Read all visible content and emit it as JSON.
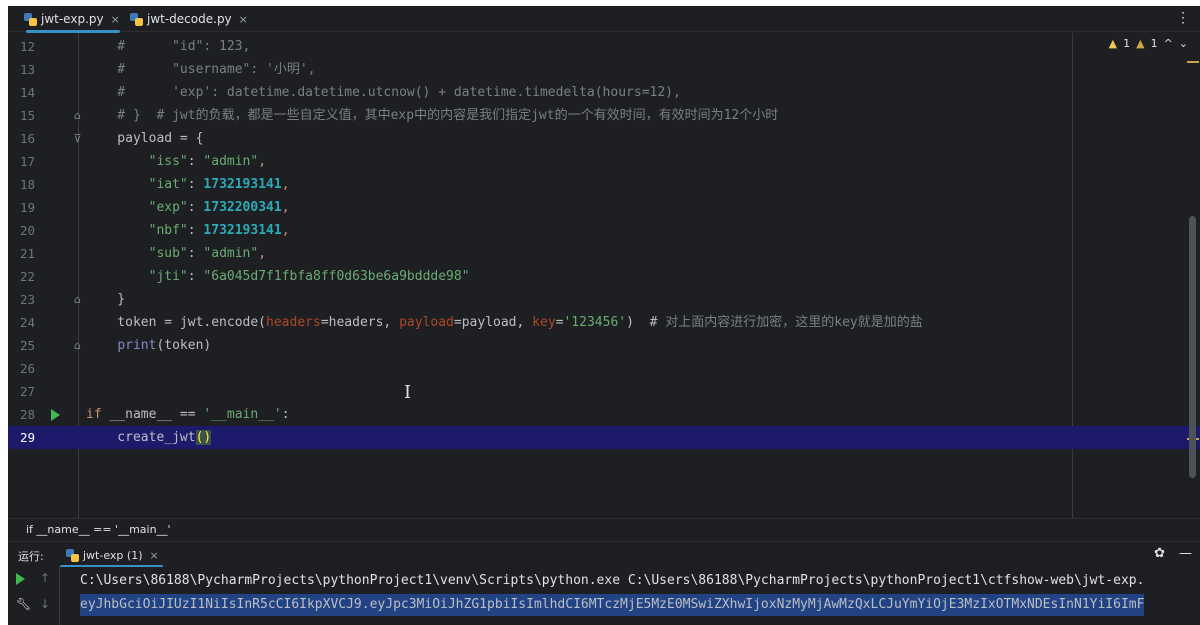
{
  "tabs": [
    {
      "label": "jwt-exp.py",
      "active": true
    },
    {
      "label": "jwt-decode.py",
      "active": false
    }
  ],
  "tab_close": "×",
  "tab_menu": "⋮",
  "inspections": {
    "warnings": "1",
    "weak": "1",
    "up": "^",
    "down": "⌄"
  },
  "code_lines": [
    {
      "n": "12",
      "parts": [
        {
          "t": "    #      \"id\": 123,",
          "c": "cm"
        }
      ]
    },
    {
      "n": "13",
      "parts": [
        {
          "t": "    #      \"username\": '",
          "c": "cm"
        },
        {
          "t": "小明",
          "c": "cm-cn"
        },
        {
          "t": "',",
          "c": "cm"
        }
      ]
    },
    {
      "n": "14",
      "parts": [
        {
          "t": "    #      'exp': datetime.datetime.utcnow() + datetime.timedelta(hours=12),",
          "c": "cm"
        }
      ]
    },
    {
      "n": "15",
      "fold": "end",
      "parts": [
        {
          "t": "    # }  # jwt",
          "c": "cm"
        },
        {
          "t": "的负载，都是一些自定义值，其中",
          "c": "cm-cn"
        },
        {
          "t": "exp",
          "c": "cm"
        },
        {
          "t": "中的内容是我们指定",
          "c": "cm-cn"
        },
        {
          "t": "jwt",
          "c": "cm"
        },
        {
          "t": "的一个有效时间，有效时间为",
          "c": "cm-cn"
        },
        {
          "t": "12",
          "c": "cm"
        },
        {
          "t": "个小时",
          "c": "cm-cn"
        }
      ]
    },
    {
      "n": "16",
      "fold": "start",
      "parts": [
        {
          "t": "    payload = {",
          "c": "fn"
        }
      ]
    },
    {
      "n": "17",
      "parts": [
        {
          "t": "        ",
          "c": "fn"
        },
        {
          "t": "\"iss\"",
          "c": "str"
        },
        {
          "t": ": ",
          "c": "fn"
        },
        {
          "t": "\"admin\"",
          "c": "str"
        },
        {
          "t": ",",
          "c": "kw"
        }
      ]
    },
    {
      "n": "18",
      "parts": [
        {
          "t": "        ",
          "c": "fn"
        },
        {
          "t": "\"iat\"",
          "c": "str"
        },
        {
          "t": ": ",
          "c": "fn"
        },
        {
          "t": "1732193141",
          "c": "num"
        },
        {
          "t": ",",
          "c": "kw"
        }
      ]
    },
    {
      "n": "19",
      "parts": [
        {
          "t": "        ",
          "c": "fn"
        },
        {
          "t": "\"exp\"",
          "c": "str"
        },
        {
          "t": ": ",
          "c": "fn"
        },
        {
          "t": "1732200341",
          "c": "num"
        },
        {
          "t": ",",
          "c": "kw"
        }
      ]
    },
    {
      "n": "20",
      "parts": [
        {
          "t": "        ",
          "c": "fn"
        },
        {
          "t": "\"nbf\"",
          "c": "str"
        },
        {
          "t": ": ",
          "c": "fn"
        },
        {
          "t": "1732193141",
          "c": "num"
        },
        {
          "t": ",",
          "c": "kw"
        }
      ]
    },
    {
      "n": "21",
      "parts": [
        {
          "t": "        ",
          "c": "fn"
        },
        {
          "t": "\"sub\"",
          "c": "str"
        },
        {
          "t": ": ",
          "c": "fn"
        },
        {
          "t": "\"admin\"",
          "c": "str"
        },
        {
          "t": ",",
          "c": "kw"
        }
      ]
    },
    {
      "n": "22",
      "parts": [
        {
          "t": "        ",
          "c": "fn"
        },
        {
          "t": "\"jti\"",
          "c": "str"
        },
        {
          "t": ": ",
          "c": "fn"
        },
        {
          "t": "\"6a045d7f1fbfa8ff0d63be6a9bddde98\"",
          "c": "str"
        }
      ]
    },
    {
      "n": "23",
      "fold": "end",
      "parts": [
        {
          "t": "    }",
          "c": "fn"
        }
      ]
    },
    {
      "n": "24",
      "parts": [
        {
          "t": "    token = jwt.encode(",
          "c": "fn"
        },
        {
          "t": "headers",
          "c": "par"
        },
        {
          "t": "=headers, ",
          "c": "fn"
        },
        {
          "t": "payload",
          "c": "par"
        },
        {
          "t": "=payload, ",
          "c": "fn"
        },
        {
          "t": "key",
          "c": "par"
        },
        {
          "t": "=",
          "c": "fn"
        },
        {
          "t": "'123456'",
          "c": "str"
        },
        {
          "t": ")  # ",
          "c": "fn"
        },
        {
          "t": "对上面内容进行加密，这里的",
          "c": "cm-cn"
        },
        {
          "t": "key",
          "c": "cm"
        },
        {
          "t": "就是加的盐",
          "c": "cm-cn"
        }
      ]
    },
    {
      "n": "25",
      "fold": "end",
      "parts": [
        {
          "t": "    ",
          "c": "fn"
        },
        {
          "t": "print",
          "c": "bi"
        },
        {
          "t": "(token)",
          "c": "fn"
        }
      ]
    },
    {
      "n": "26",
      "parts": []
    },
    {
      "n": "27",
      "parts": []
    },
    {
      "n": "28",
      "run": true,
      "parts": [
        {
          "t": "if",
          "c": "kw"
        },
        {
          "t": " __name__ == ",
          "c": "fn"
        },
        {
          "t": "'__main__'",
          "c": "str"
        },
        {
          "t": ":",
          "c": "fn"
        }
      ]
    },
    {
      "n": "29",
      "current": true,
      "parts": [
        {
          "t": "    create_jwt",
          "c": "fn"
        },
        {
          "t": "()",
          "c": "brk-hl"
        }
      ]
    }
  ],
  "text_caret": "I",
  "breadcrumb": "if __name__ == '__main__'",
  "run_panel": {
    "label": "运行:",
    "tab": "jwt-exp (1)",
    "close": "×",
    "settings_icon": "✿",
    "minimize_icon": "—"
  },
  "console_lines": [
    "C:\\Users\\86188\\PycharmProjects\\pythonProject1\\venv\\Scripts\\python.exe C:\\Users\\86188\\PycharmProjects\\pythonProject1\\ctfshow-web\\jwt-exp.",
    "eyJhbGciOiJIUzI1NiIsInR5cCI6IkpXVCJ9.eyJpc3MiOiJhZG1pbiIsImlhdCI6MTczMjE5MzE0MSwiZXhwIjoxNzMyMjAwMzQxLCJuYmYiOjE3MzIxOTMxNDEsInN1YiI6ImF"
  ],
  "console_tools": {
    "up": "↑",
    "down": "↓",
    "wrench": "🔧"
  }
}
